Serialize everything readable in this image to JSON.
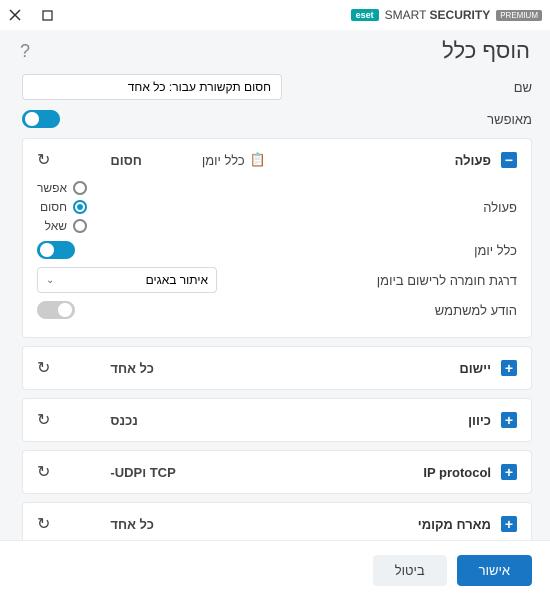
{
  "brand": {
    "badge": "eset",
    "name_light": "SMART ",
    "name_bold": "SECURITY",
    "tag": "PREMIUM"
  },
  "page_title": "הוסף כלל",
  "help": "?",
  "name_field": {
    "label": "שם",
    "value": "חסום תקשורת עבור: כל אחד"
  },
  "enabled": {
    "label": "מאופשר",
    "on": true
  },
  "action_panel": {
    "title": "פעולה",
    "summary": "חסום",
    "log_chip": "כלל יומן",
    "expanded": true,
    "action": {
      "label": "פעולה",
      "options": [
        "אפשר",
        "חסום",
        "שאל"
      ],
      "selected": "חסום"
    },
    "log_rule": {
      "label": "כלל יומן",
      "on": true
    },
    "severity": {
      "label": "דרגת חומרה לרישום ביומן",
      "value": "איתור באגים"
    },
    "notify": {
      "label": "הודע למשתמש",
      "on": false
    }
  },
  "panels": [
    {
      "key": "app",
      "title": "יישום",
      "summary": "כל אחד"
    },
    {
      "key": "dir",
      "title": "כיוון",
      "summary": "נכנס"
    },
    {
      "key": "proto",
      "title": "IP protocol",
      "summary": "-UDPו TCP"
    },
    {
      "key": "local",
      "title": "מארח מקומי",
      "summary": "כל אחד"
    }
  ],
  "footer": {
    "ok": "אישור",
    "cancel": "ביטול"
  },
  "icons": {
    "reset": "↻",
    "clip": "📋",
    "chev": "⌄"
  }
}
